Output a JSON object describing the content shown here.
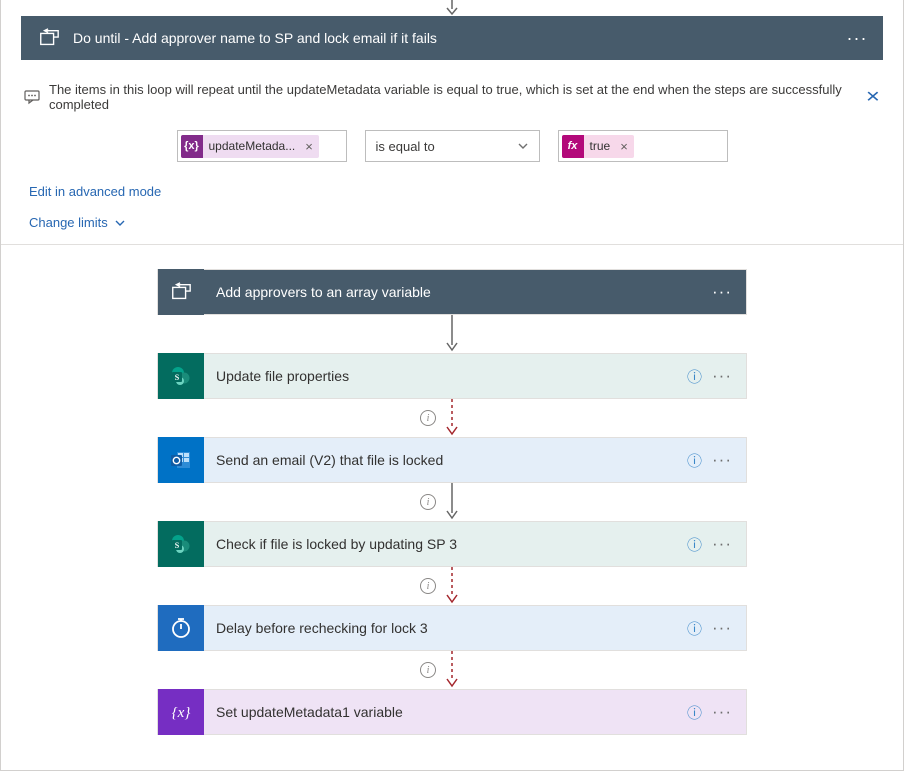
{
  "header": {
    "title": "Do until - Add approver name to SP and lock email if it fails"
  },
  "comment_text": "The items in this loop will repeat until the updateMetadata variable is equal to true, which is set at the end when the steps are successfully completed",
  "condition": {
    "left_label": "updateMetada...",
    "left_badge": "{x}",
    "operator": "is equal to",
    "right_label": "true",
    "right_badge": "fx"
  },
  "links": {
    "advanced": "Edit in advanced mode",
    "limits": "Change limits"
  },
  "actions": [
    {
      "title": "Add approvers to an array variable",
      "style": "loop"
    },
    {
      "title": "Update file properties",
      "style": "teal",
      "help": true
    },
    {
      "title": "Send an email (V2) that file is locked",
      "style": "outlook",
      "help": true
    },
    {
      "title": "Check if file is locked by updating SP 3",
      "style": "teal",
      "help": true
    },
    {
      "title": "Delay before rechecking for lock 3",
      "style": "delay",
      "help": true
    },
    {
      "title": "Set updateMetadata1 variable",
      "style": "variable",
      "help": true
    }
  ],
  "connectors": [
    {
      "kind": "solid"
    },
    {
      "kind": "dashed_info"
    },
    {
      "kind": "solid_info"
    },
    {
      "kind": "dashed_info"
    },
    {
      "kind": "dashed_info"
    },
    {
      "kind": "dashed_info"
    }
  ]
}
